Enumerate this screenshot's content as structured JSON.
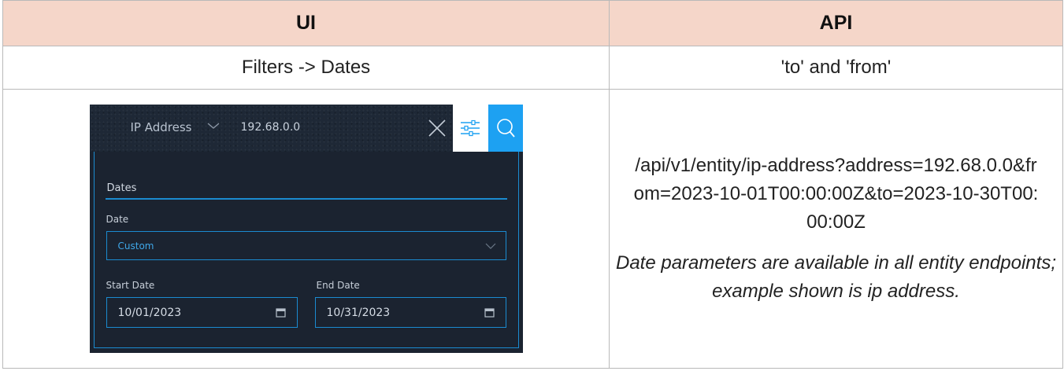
{
  "table": {
    "headers": [
      "UI",
      "API"
    ],
    "row_labels": {
      "ui": "Filters -> Dates",
      "api": "'to' and 'from'"
    },
    "api_example": "/api/v1/entity/ip-address?address=192.68.0.0&from=2023-10-01T00:00:00Z&to=2023-10-30T00:00:00Z",
    "api_note": "Date parameters are available in all entity endpoints; example shown is ip address."
  },
  "ui_panel": {
    "field_select": "IP Address",
    "search_value": "192.68.0.0",
    "tab_label": "Dates",
    "date_label": "Date",
    "date_select_value": "Custom",
    "start_date_label": "Start Date",
    "start_date_value": "10/01/2023",
    "end_date_label": "End Date",
    "end_date_value": "10/31/2023",
    "icons": [
      "chevron-down-icon",
      "close-icon",
      "filter-sliders-icon",
      "search-icon",
      "calendar-icon"
    ],
    "colors": {
      "accent": "#1da1f2",
      "panel_bg": "#1b2330",
      "header_bg": "#f5d6c9"
    }
  }
}
